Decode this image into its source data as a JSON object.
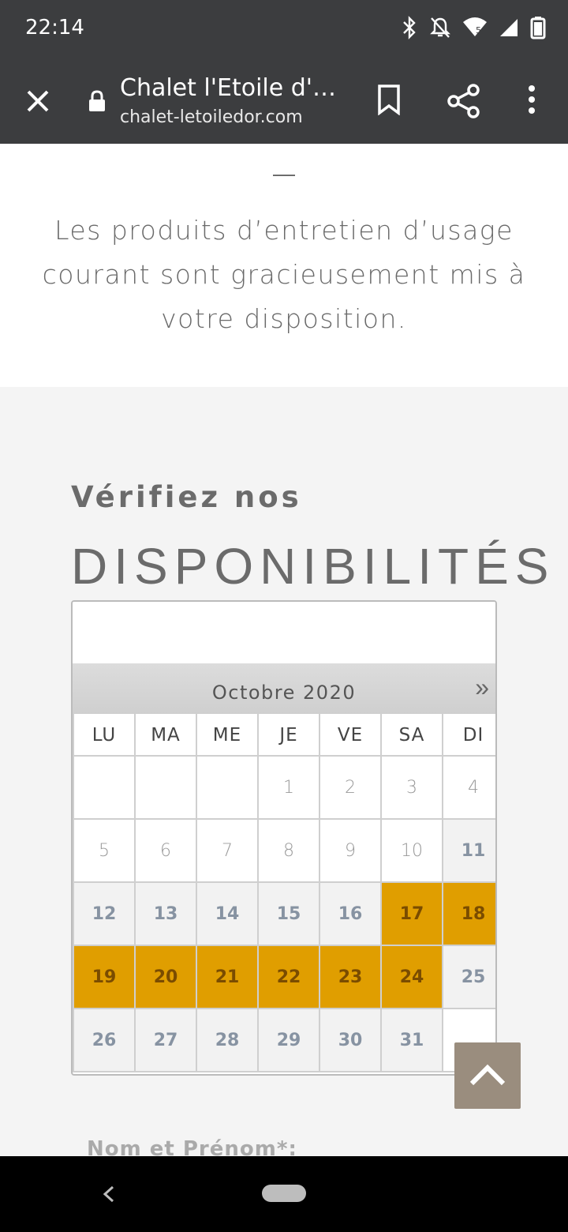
{
  "status_bar": {
    "time": "22:14",
    "icons": [
      "bluetooth-icon",
      "do-not-disturb-icon",
      "wifi-icon",
      "signal-icon",
      "battery-icon"
    ]
  },
  "browser": {
    "title": "Chalet l'Etoile d'O...",
    "url": "chalet-letoiledor.com",
    "icons": [
      "close-icon",
      "lock-icon",
      "bookmark-icon",
      "share-icon",
      "more-vert-icon"
    ]
  },
  "content": {
    "dash": "—",
    "description": "Les produits d’entretien d’usage courant sont gracieusement mis à votre disposition."
  },
  "availability": {
    "heading_small": "Vérifiez nos",
    "heading_big": "DISPONIBILITÉS"
  },
  "calendar": {
    "month_label": "Octobre 2020",
    "next_label": "»",
    "weekdays": [
      "LU",
      "MA",
      "ME",
      "JE",
      "VE",
      "SA",
      "DI"
    ],
    "rows": [
      [
        {
          "d": "",
          "s": "empty"
        },
        {
          "d": "",
          "s": "empty"
        },
        {
          "d": "",
          "s": "empty"
        },
        {
          "d": "1",
          "s": "past"
        },
        {
          "d": "2",
          "s": "past"
        },
        {
          "d": "3",
          "s": "past"
        },
        {
          "d": "4",
          "s": "past"
        }
      ],
      [
        {
          "d": "5",
          "s": "past"
        },
        {
          "d": "6",
          "s": "past"
        },
        {
          "d": "7",
          "s": "past"
        },
        {
          "d": "8",
          "s": "past"
        },
        {
          "d": "9",
          "s": "past"
        },
        {
          "d": "10",
          "s": "past"
        },
        {
          "d": "11",
          "s": "avail"
        }
      ],
      [
        {
          "d": "12",
          "s": "avail"
        },
        {
          "d": "13",
          "s": "avail"
        },
        {
          "d": "14",
          "s": "avail"
        },
        {
          "d": "15",
          "s": "avail"
        },
        {
          "d": "16",
          "s": "avail"
        },
        {
          "d": "17",
          "s": "booked"
        },
        {
          "d": "18",
          "s": "booked"
        }
      ],
      [
        {
          "d": "19",
          "s": "booked"
        },
        {
          "d": "20",
          "s": "booked"
        },
        {
          "d": "21",
          "s": "booked"
        },
        {
          "d": "22",
          "s": "booked"
        },
        {
          "d": "23",
          "s": "booked"
        },
        {
          "d": "24",
          "s": "booked"
        },
        {
          "d": "25",
          "s": "avail"
        }
      ],
      [
        {
          "d": "26",
          "s": "avail"
        },
        {
          "d": "27",
          "s": "avail"
        },
        {
          "d": "28",
          "s": "avail"
        },
        {
          "d": "29",
          "s": "avail"
        },
        {
          "d": "30",
          "s": "avail"
        },
        {
          "d": "31",
          "s": "avail"
        },
        {
          "d": "",
          "s": "empty"
        }
      ]
    ],
    "colors": {
      "booked": "#e09e00",
      "available_text": "#8793a2"
    }
  },
  "form": {
    "first_label": "Nom et Prénom*:"
  },
  "back_to_top": {
    "icon": "chevron-up-icon"
  },
  "nav_bar": {
    "icons": [
      "back-icon",
      "home-pill-icon"
    ]
  }
}
